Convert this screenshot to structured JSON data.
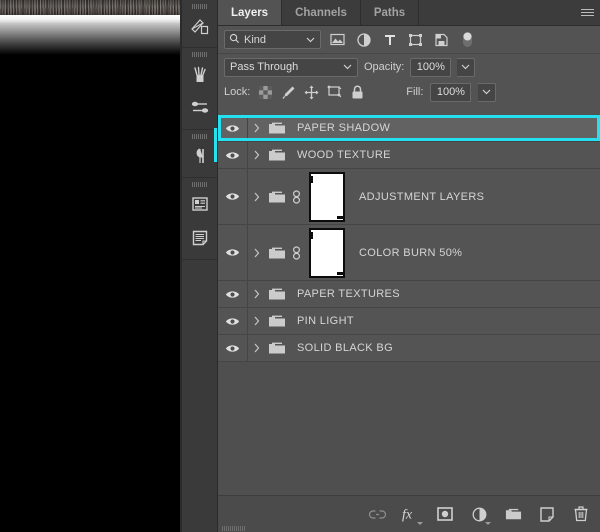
{
  "panel": {
    "tabs": [
      {
        "label": "Layers",
        "active": true
      },
      {
        "label": "Channels",
        "active": false
      },
      {
        "label": "Paths",
        "active": false
      }
    ],
    "menu_icon": "hamburger-menu-icon"
  },
  "filter": {
    "kind_label": "Kind",
    "search_icon": "search-icon",
    "chevron": "⌄",
    "type_filters": [
      "pixel-layer-filter-icon",
      "adjustment-layer-filter-icon",
      "type-layer-filter-icon",
      "shape-layer-filter-icon",
      "smart-object-filter-icon",
      "filter-toggle-switch"
    ]
  },
  "blend": {
    "mode": "Pass Through",
    "opacity_label": "Opacity:",
    "opacity_value": "100%"
  },
  "lock": {
    "label": "Lock:",
    "icons": [
      "lock-transparent-pixels-icon",
      "lock-image-pixels-icon",
      "lock-position-icon",
      "lock-artboard-nesting-icon",
      "lock-all-icon"
    ],
    "fill_label": "Fill:",
    "fill_value": "100%"
  },
  "layers": [
    {
      "name": "PAPER SHADOW",
      "visible": true,
      "selected": true,
      "has_mask": false,
      "linked": false,
      "type": "group"
    },
    {
      "name": "WOOD TEXTURE",
      "visible": true,
      "selected": false,
      "has_mask": false,
      "linked": false,
      "type": "group"
    },
    {
      "name": "ADJUSTMENT LAYERS",
      "visible": true,
      "selected": false,
      "has_mask": true,
      "linked": true,
      "type": "group"
    },
    {
      "name": "COLOR BURN 50%",
      "visible": true,
      "selected": false,
      "has_mask": true,
      "linked": true,
      "type": "group"
    },
    {
      "name": "PAPER TEXTURES",
      "visible": true,
      "selected": false,
      "has_mask": false,
      "linked": false,
      "type": "group"
    },
    {
      "name": "PIN LIGHT",
      "visible": true,
      "selected": false,
      "has_mask": false,
      "linked": false,
      "type": "group"
    },
    {
      "name": "SOLID BLACK BG",
      "visible": true,
      "selected": false,
      "has_mask": false,
      "linked": false,
      "type": "group"
    }
  ],
  "bottom_toolbar": [
    "link-layers-icon",
    "layer-styles-fx-icon",
    "add-layer-mask-icon",
    "new-adjustment-layer-icon",
    "new-group-icon",
    "new-layer-icon",
    "delete-layer-icon"
  ],
  "icon_dock": [
    "styles-panel-icon",
    "brushes-panel-icon",
    "brush-settings-panel-icon",
    "paragraph-panel-icon",
    "properties-panel-icon",
    "notes-panel-icon"
  ],
  "colors": {
    "selection_highlight": "#25e0ef",
    "panel_background": "#535353",
    "layer_row": "#545454",
    "layer_row_selected": "#626262",
    "text": "#d5d5d5",
    "canvas_black": "#000000"
  }
}
